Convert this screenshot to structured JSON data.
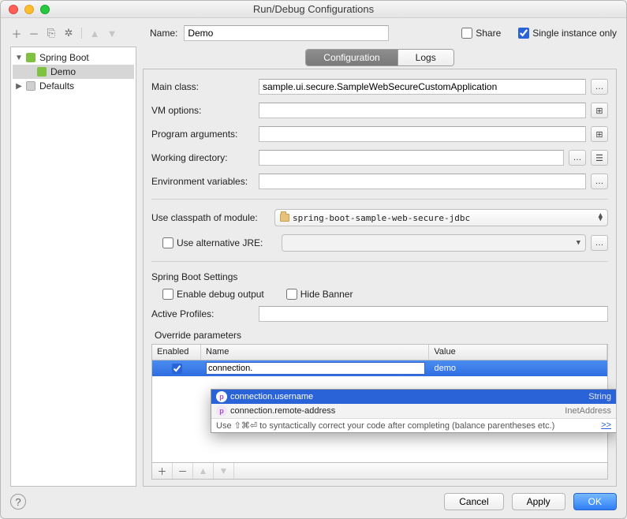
{
  "window": {
    "title": "Run/Debug Configurations"
  },
  "topbar": {
    "name_label": "Name:",
    "name_value": "Demo",
    "share_label": "Share",
    "single_instance_label": "Single instance only",
    "share_checked": false,
    "single_instance_checked": true
  },
  "sidebar": {
    "tree": [
      {
        "label": "Spring Boot",
        "expanded": true,
        "children": [
          {
            "label": "Demo",
            "selected": true
          }
        ]
      },
      {
        "label": "Defaults",
        "expanded": false
      }
    ]
  },
  "tabs": {
    "configuration": "Configuration",
    "logs": "Logs"
  },
  "form": {
    "main_class_label": "Main class:",
    "main_class_value": "sample.ui.secure.SampleWebSecureCustomApplication",
    "vm_options_label": "VM options:",
    "program_args_label": "Program arguments:",
    "working_dir_label": "Working directory:",
    "env_vars_label": "Environment variables:",
    "use_classpath_label": "Use classpath of module:",
    "classpath_module": "spring-boot-sample-web-secure-jdbc",
    "use_alt_jre_label": "Use alternative JRE:",
    "spring_settings_legend": "Spring Boot Settings",
    "enable_debug_label": "Enable debug output",
    "hide_banner_label": "Hide Banner",
    "active_profiles_label": "Active Profiles:",
    "override_legend": "Override parameters",
    "grid": {
      "col_enabled": "Enabled",
      "col_name": "Name",
      "col_value": "Value",
      "rows": [
        {
          "enabled": true,
          "name": "connection.",
          "value": "demo"
        }
      ]
    },
    "autocomplete": {
      "items": [
        {
          "name": "connection.username",
          "type": "String",
          "highlight": true
        },
        {
          "name": "connection.remote-address",
          "type": "InetAddress",
          "highlight": false
        }
      ],
      "hint": "Use ⇧⌘⏎ to syntactically correct your code after completing (balance parentheses etc.)",
      "more": ">>"
    }
  },
  "buttons": {
    "cancel": "Cancel",
    "apply": "Apply",
    "ok": "OK"
  }
}
